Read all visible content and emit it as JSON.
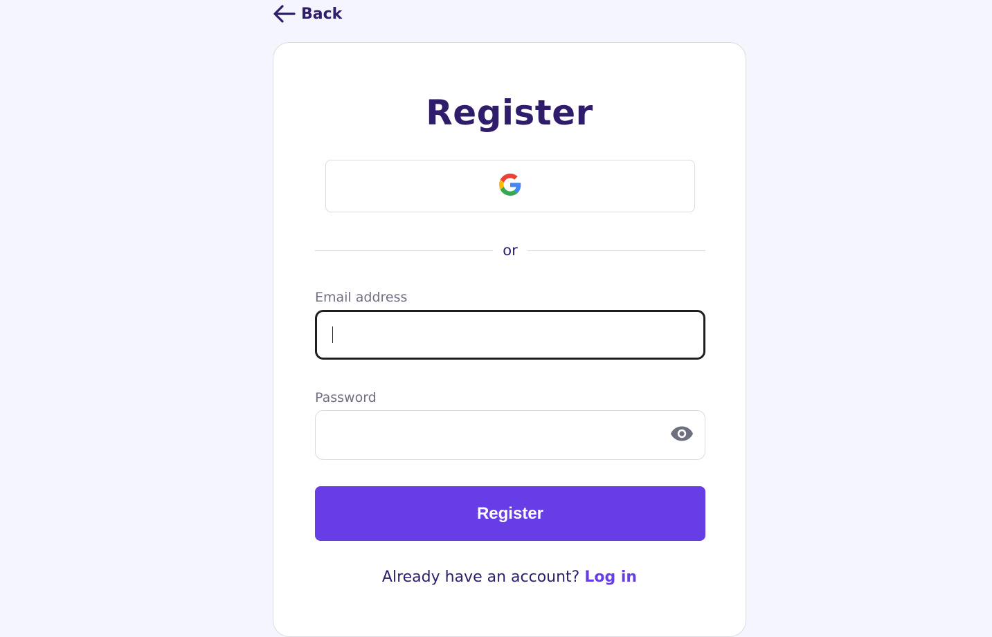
{
  "nav": {
    "back_label": "Back",
    "back_icon": "arrow-left-icon"
  },
  "card": {
    "title": "Register",
    "google_icon": "google-icon",
    "divider_text": "or",
    "email": {
      "label": "Email address",
      "value": "",
      "placeholder": ""
    },
    "password": {
      "label": "Password",
      "value": "",
      "placeholder": "",
      "toggle_icon": "eye-icon"
    },
    "submit_label": "Register",
    "login_prompt": "Already have an account?",
    "login_link": "Log in"
  },
  "colors": {
    "background": "#f4f5ff",
    "primary": "#673de6",
    "heading": "#2f1c6a",
    "label": "#6d7081",
    "border": "#dadce0"
  }
}
